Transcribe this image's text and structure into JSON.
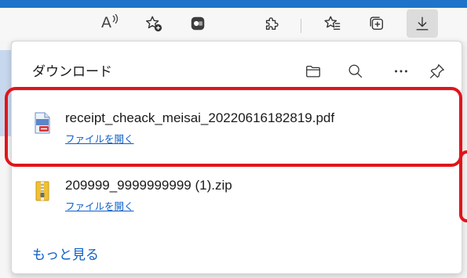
{
  "colors": {
    "accent": "#1f74c9",
    "link": "#0d5fc7",
    "highlight": "#e0151b"
  },
  "toolbar": {
    "read_aloud_glyph": "A",
    "buttons": [
      {
        "icon": "read-aloud-icon"
      },
      {
        "icon": "add-favorite-icon"
      },
      {
        "icon": "extension-app-icon"
      },
      {
        "icon": "extensions-icon"
      },
      {
        "icon": "favorites-icon"
      },
      {
        "icon": "collections-icon"
      },
      {
        "icon": "download-icon"
      }
    ]
  },
  "panel": {
    "title": "ダウンロード",
    "header_icons": [
      "folder-icon",
      "search-icon",
      "more-icon",
      "pin-icon"
    ],
    "items": [
      {
        "filename": "receipt_cheack_meisai_20220616182819.pdf",
        "action": "ファイルを開く",
        "icon": "pdf-file-icon"
      },
      {
        "filename": "209999_9999999999 (1).zip",
        "action": "ファイルを開く",
        "icon": "zip-file-icon"
      }
    ],
    "more_label": "もっと見る"
  }
}
